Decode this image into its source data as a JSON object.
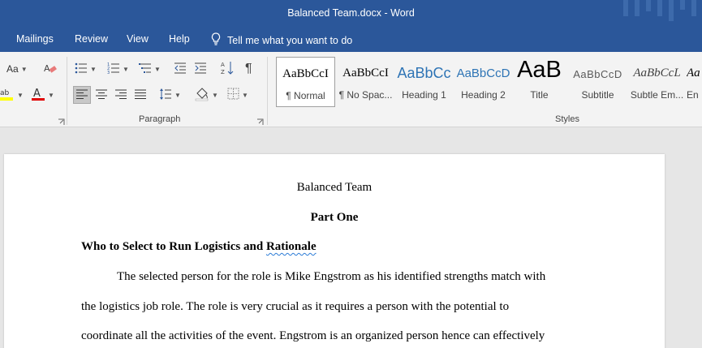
{
  "window": {
    "title": "Balanced Team.docx - Word"
  },
  "tabs": [
    "Mailings",
    "Review",
    "View",
    "Help"
  ],
  "tell_me": "Tell me what you want to do",
  "ribbon": {
    "font_case_label": "Aa",
    "paragraph_label": "Paragraph",
    "styles_label": "Styles",
    "styles": [
      {
        "sample": "AaBbCcI",
        "name": "¶ Normal"
      },
      {
        "sample": "AaBbCcI",
        "name": "¶ No Spac..."
      },
      {
        "sample": "AaBbCc",
        "name": "Heading 1"
      },
      {
        "sample": "AaBbCcD",
        "name": "Heading 2"
      },
      {
        "sample": "AaB",
        "name": "Title"
      },
      {
        "sample": "AaBbCcD",
        "name": "Subtitle"
      },
      {
        "sample": "AaBbCcL",
        "name": "Subtle Em..."
      },
      {
        "sample": "Aa",
        "name": "En"
      }
    ]
  },
  "document": {
    "title": "Balanced Team",
    "part": "Part One",
    "heading_main": "Who to Select to Run Logistics and ",
    "heading_flagged": "Rationale",
    "lines": [
      "The selected person for the role is Mike Engstrom as his identified strengths match with",
      "the logistics job role. The role is very crucial as it requires a person with the potential to",
      "coordinate all the activities of the event. Engstrom is an organized person hence can effectively"
    ]
  },
  "colors": {
    "brand": "#2b579a",
    "ribbon": "#f3f3f3",
    "highlight_yellow": "#ffff00",
    "font_red": "#e00000"
  }
}
